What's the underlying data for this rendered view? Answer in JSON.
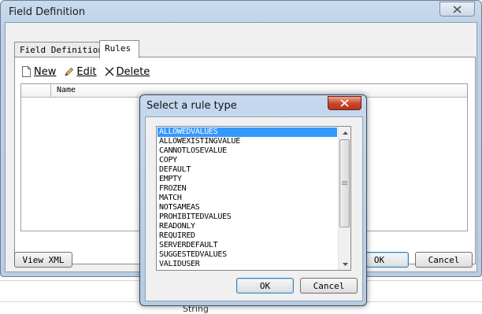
{
  "window": {
    "title": "Field Definition",
    "tabs": [
      {
        "label": "Field Definition",
        "active": false
      },
      {
        "label": "Rules",
        "active": true
      }
    ],
    "toolbar": {
      "new_label": "New",
      "edit_label": "Edit",
      "delete_label": "Delete"
    },
    "grid": {
      "columns": [
        "Name"
      ]
    },
    "view_xml_label": "View XML",
    "ok_label": "OK",
    "cancel_label": "Cancel"
  },
  "dialog": {
    "title": "Select a rule type",
    "items": [
      "ALLOWEDVALUES",
      "ALLOWEXISTINGVALUE",
      "CANNOTLOSEVALUE",
      "COPY",
      "DEFAULT",
      "EMPTY",
      "FROZEN",
      "MATCH",
      "NOTSAMEAS",
      "PROHIBITEDVALUES",
      "READONLY",
      "REQUIRED",
      "SERVERDEFAULT",
      "SUGGESTEDVALUES",
      "VALIDUSER"
    ],
    "selected_item": "ALLOWEDVALUES",
    "ok_label": "OK",
    "cancel_label": "Cancel"
  },
  "background": {
    "text": "String"
  },
  "colors": {
    "selection": "#3399ff",
    "dialog_close": "#c9452a",
    "window_frame": "#bcd0e6"
  }
}
